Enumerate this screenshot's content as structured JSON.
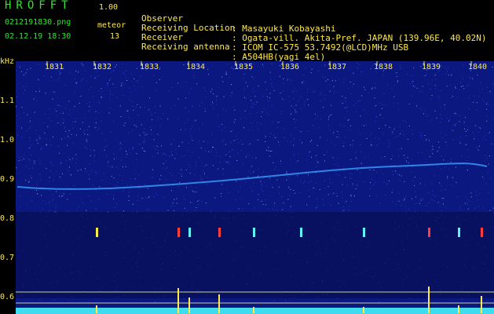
{
  "app": {
    "title": "HROFFT",
    "version": "1.00",
    "filename": "0212191830.png",
    "datetime": "02.12.19 18:30",
    "meteor_label": "meteor",
    "meteor_count": "13"
  },
  "info": [
    {
      "label": "Observer",
      "value": ": Masayuki Kobayashi"
    },
    {
      "label": "Receiving Location",
      "value": ": Ogata-vill. Akita-Pref. JAPAN (139.96E, 40.02N)"
    },
    {
      "label": "Receiver",
      "value": ": ICOM IC-575 53.7492(@LCD)MHz USB"
    },
    {
      "label": "Receiving antenna",
      "value": ": A504HB(yagi 4el)"
    }
  ],
  "axes": {
    "y_unit": "kHz",
    "y_ticks": [
      "1.1",
      "1.0",
      "0.9",
      "0.8",
      "0.7",
      "0.6"
    ],
    "x_ticks": [
      "1831",
      "1832",
      "1833",
      "1834",
      "1835",
      "1836",
      "1837",
      "1838",
      "1839",
      "1840"
    ]
  },
  "colors": {
    "background": "#000000",
    "spectrum": "#0b1a8a",
    "text_yellow": "#ffe94a",
    "text_green": "#2ee62e",
    "signal_cyan": "#5ff2ff"
  }
}
